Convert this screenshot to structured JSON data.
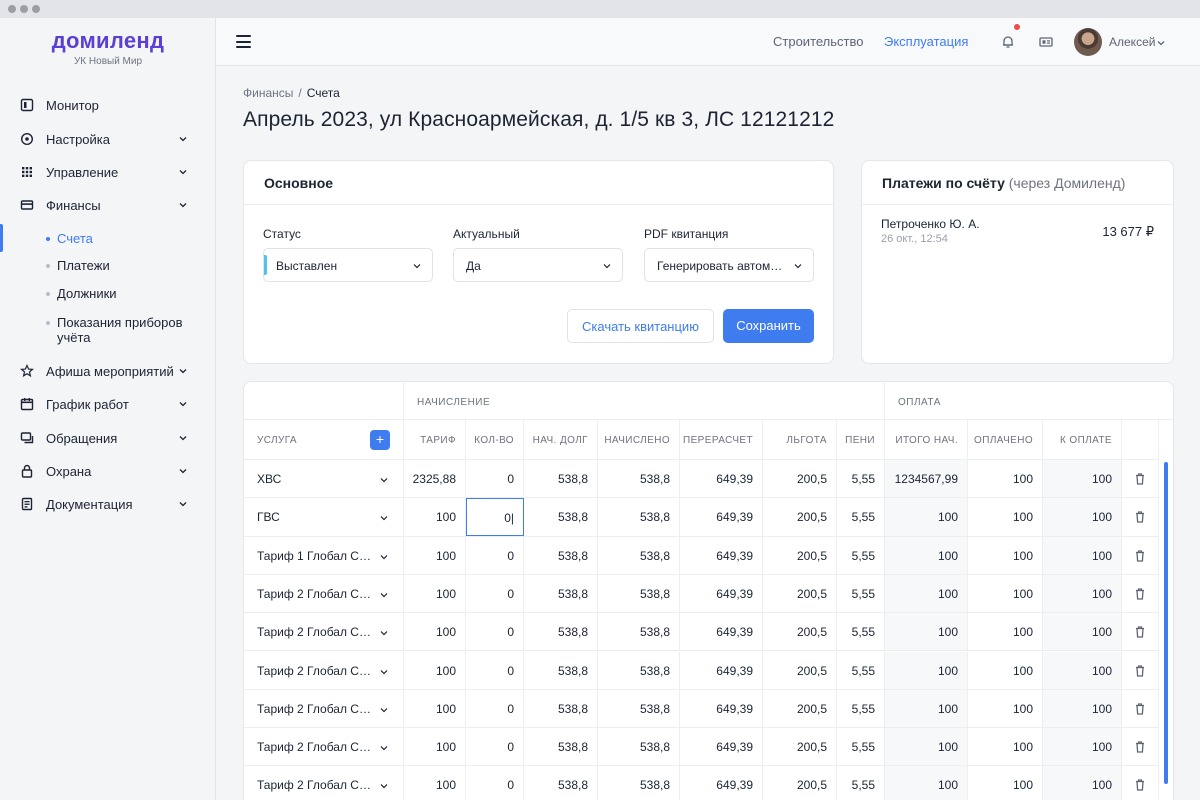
{
  "brand": {
    "name": "домиленд",
    "subtitle": "УК Новый Мир"
  },
  "sidebar": {
    "items": [
      {
        "label": "Монитор",
        "icon": "monitor-icon",
        "expandable": false
      },
      {
        "label": "Настройка",
        "icon": "settings-icon",
        "expandable": true
      },
      {
        "label": "Управление",
        "icon": "grid-icon",
        "expandable": true
      },
      {
        "label": "Финансы",
        "icon": "wallet-icon",
        "expandable": true
      },
      {
        "label": "Афиша мероприятий",
        "icon": "star-icon",
        "expandable": true
      },
      {
        "label": "График работ",
        "icon": "calendar-icon",
        "expandable": true
      },
      {
        "label": "Обращения",
        "icon": "chat-icon",
        "expandable": true
      },
      {
        "label": "Охрана",
        "icon": "lock-icon",
        "expandable": true
      },
      {
        "label": "Документация",
        "icon": "document-icon",
        "expandable": true
      }
    ],
    "finance_sub": [
      {
        "label": "Счета",
        "active": true
      },
      {
        "label": "Платежи",
        "active": false
      },
      {
        "label": "Должники",
        "active": false
      },
      {
        "label": "Показания приборов учёта",
        "active": false
      }
    ]
  },
  "topbar": {
    "links": [
      {
        "label": "Строительство",
        "active": false
      },
      {
        "label": "Эксплуатация",
        "active": true
      }
    ],
    "user_name": "Алексей",
    "icons": [
      "menu-icon",
      "bell-icon",
      "news-icon"
    ]
  },
  "breadcrumb": {
    "parent": "Финансы",
    "separator": "/",
    "current": "Счета"
  },
  "page_title": "Апрель 2023, ул Красноармейская, д. 1/5 кв 3, ЛС 12121212",
  "main_card": {
    "title": "Основное",
    "fields": [
      {
        "label": "Статус",
        "value": "Выставлен"
      },
      {
        "label": "Актуальный",
        "value": "Да"
      },
      {
        "label": "PDF квитанция",
        "value": "Генерировать автомат..."
      }
    ],
    "download_label": "Скачать квитанцию",
    "save_label": "Сохранить"
  },
  "payments_card": {
    "title": "Платежи по счёту",
    "title_muted": "(через Домиленд)",
    "payments": [
      {
        "name": "Петроченко Ю. А.",
        "time": "26 окт., 12:54",
        "amount": "13 677 ₽"
      }
    ]
  },
  "table": {
    "group_accrual": "НАЧИСЛЕНИЕ",
    "group_payment": "ОПЛАТА",
    "add_label": "+",
    "columns": [
      "УСЛУГА",
      "ТАРИФ",
      "КОЛ-ВО",
      "НАЧ. ДОЛГ",
      "НАЧИСЛЕНО",
      "ПЕРЕРАСЧЕТ",
      "ЛЬГОТА",
      "ПЕНИ",
      "ИТОГО НАЧ.",
      "ОПЛАЧЕНО",
      "К ОПЛАТЕ"
    ],
    "rows": [
      [
        "ХВС",
        "2325,88",
        "0",
        "538,8",
        "538,8",
        "649,39",
        "200,5",
        "5,55",
        "1234567,99",
        "100",
        "100"
      ],
      [
        "ГВС",
        "100",
        "0|",
        "538,8",
        "538,8",
        "649,39",
        "200,5",
        "5,55",
        "100",
        "100",
        "100"
      ],
      [
        "Тариф 1 Глобал Серв...",
        "100",
        "0",
        "538,8",
        "538,8",
        "649,39",
        "200,5",
        "5,55",
        "100",
        "100",
        "100"
      ],
      [
        "Тариф 2 Глобал Серв...",
        "100",
        "0",
        "538,8",
        "538,8",
        "649,39",
        "200,5",
        "5,55",
        "100",
        "100",
        "100"
      ],
      [
        "Тариф 2 Глобал Серв...",
        "100",
        "0",
        "538,8",
        "538,8",
        "649,39",
        "200,5",
        "5,55",
        "100",
        "100",
        "100"
      ],
      [
        "Тариф 2 Глобал Серв...",
        "100",
        "0",
        "538,8",
        "538,8",
        "649,39",
        "200,5",
        "5,55",
        "100",
        "100",
        "100"
      ],
      [
        "Тариф 2 Глобал Серв...",
        "100",
        "0",
        "538,8",
        "538,8",
        "649,39",
        "200,5",
        "5,55",
        "100",
        "100",
        "100"
      ],
      [
        "Тариф 2 Глобал Серв...",
        "100",
        "0",
        "538,8",
        "538,8",
        "649,39",
        "200,5",
        "5,55",
        "100",
        "100",
        "100"
      ],
      [
        "Тариф 2 Глобал Серв...",
        "100",
        "0",
        "538,8",
        "538,8",
        "649,39",
        "200,5",
        "5,55",
        "100",
        "100",
        "100"
      ]
    ],
    "editing_cell": {
      "row": 1,
      "col": 2
    }
  },
  "colors": {
    "brand": "#5b3fd6",
    "accent": "#3e7cf0",
    "notification": "#ef4a4a",
    "status": "#4ec3ee"
  }
}
